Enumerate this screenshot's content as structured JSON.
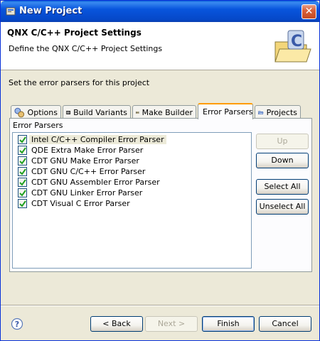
{
  "window": {
    "title": "New Project",
    "close_label": "✕"
  },
  "banner": {
    "title": "QNX C/C++ Project Settings",
    "description": "Define the QNX C/C++ Project Settings",
    "icon": "c-folder-wizard-icon"
  },
  "instruction": "Set the error parsers for this project",
  "tabs": [
    {
      "label": "Options",
      "icon": "options-icon"
    },
    {
      "label": "Build Variants",
      "icon": "build-variants-icon"
    },
    {
      "label": "Make Builder",
      "icon": "make-builder-icon"
    },
    {
      "label": "Error Parsers",
      "icon": "",
      "active": true
    },
    {
      "label": "Projects",
      "icon": "projects-folder-icon"
    }
  ],
  "error_parsers": {
    "group_label": "Error Parsers",
    "items": [
      {
        "label": "Intel C/C++ Compiler Error Parser",
        "checked": true,
        "selected": true
      },
      {
        "label": "QDE Extra Make Error Parser",
        "checked": true
      },
      {
        "label": "CDT GNU Make Error Parser",
        "checked": true
      },
      {
        "label": "CDT GNU C/C++ Error Parser",
        "checked": true
      },
      {
        "label": "CDT GNU Assembler Error Parser",
        "checked": true
      },
      {
        "label": "CDT GNU Linker Error Parser",
        "checked": true
      },
      {
        "label": "CDT Visual C Error Parser",
        "checked": true
      }
    ],
    "buttons": {
      "up": "Up",
      "down": "Down",
      "select_all": "Select All",
      "unselect_all": "Unselect All"
    }
  },
  "footer": {
    "help_icon": "help-icon",
    "back": "< Back",
    "next": "Next >",
    "finish": "Finish",
    "cancel": "Cancel"
  },
  "colors": {
    "titlebar": "#0855dd",
    "active_tab_accent": "#ff9c00",
    "checkbox_check": "#21a121"
  }
}
